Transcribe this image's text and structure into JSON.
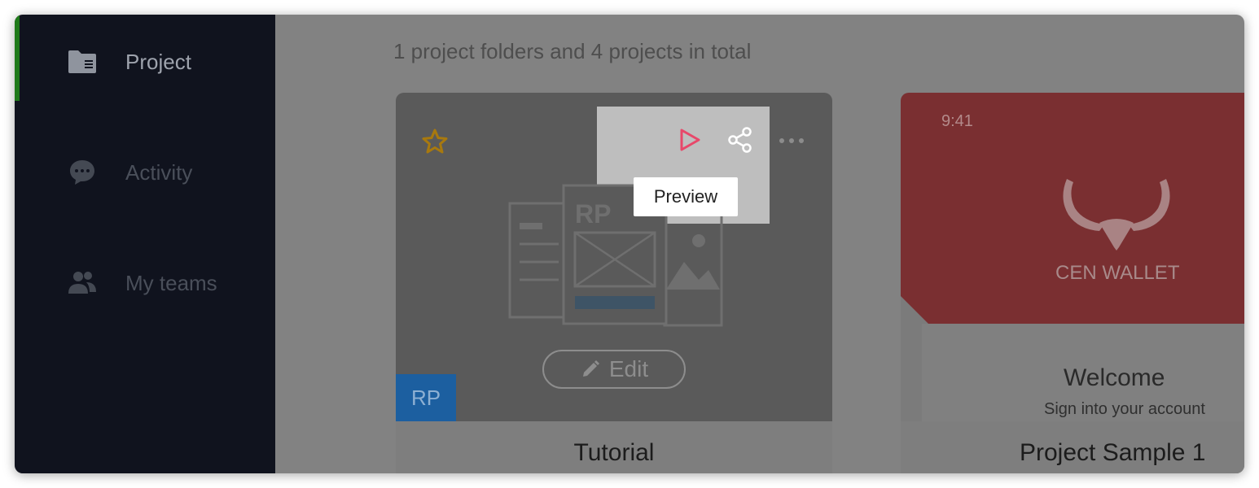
{
  "sidebar": {
    "items": [
      {
        "label": "Project",
        "icon": "folder-icon",
        "active": true
      },
      {
        "label": "Activity",
        "icon": "chat-bubble-icon",
        "active": false
      },
      {
        "label": "My teams",
        "icon": "team-icon",
        "active": false
      }
    ]
  },
  "main": {
    "summary": "1 project folders and 4 projects in total",
    "cards": [
      {
        "title": "Tutorial",
        "badge": "RP",
        "edit_label": "Edit",
        "preview_tooltip": "Preview",
        "illustration_text": "RP"
      },
      {
        "title": "Project Sample 1",
        "time": "9:41",
        "brand": "CEN WALLET",
        "welcome": "Welcome",
        "signin": "Sign into your account"
      }
    ]
  },
  "colors": {
    "sidebar_bg": "#10131e",
    "active_indicator": "#1f7a1a",
    "play_icon": "#e8486a",
    "star_icon": "#a8790e",
    "badge_bg": "#1c5fa0"
  }
}
